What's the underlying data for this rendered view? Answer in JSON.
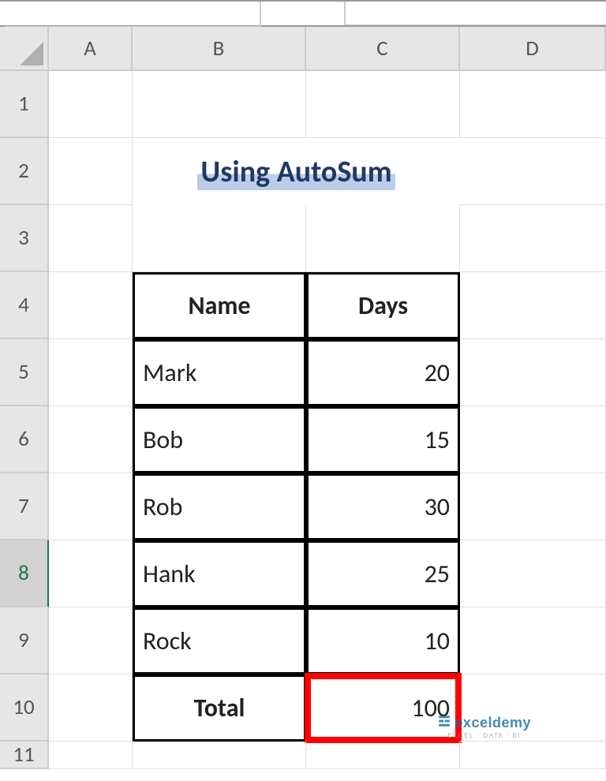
{
  "columns": [
    "A",
    "B",
    "C",
    "D"
  ],
  "rows": [
    "1",
    "2",
    "3",
    "4",
    "5",
    "6",
    "7",
    "8",
    "9",
    "10",
    "11"
  ],
  "active_row": "8",
  "title": "Using AutoSum",
  "table": {
    "headers": {
      "name": "Name",
      "days": "Days"
    },
    "rows": [
      {
        "name": "Mark",
        "days": "20"
      },
      {
        "name": "Bob",
        "days": "15"
      },
      {
        "name": "Rob",
        "days": "30"
      },
      {
        "name": "Hank",
        "days": "25"
      },
      {
        "name": "Rock",
        "days": "10"
      }
    ],
    "total_label": "Total",
    "total_value": "100"
  },
  "watermark": {
    "brand": "exceldemy",
    "tagline": "EXCEL · DATA · BI"
  },
  "chart_data": {
    "type": "table",
    "title": "Using AutoSum",
    "columns": [
      "Name",
      "Days"
    ],
    "rows": [
      [
        "Mark",
        20
      ],
      [
        "Bob",
        15
      ],
      [
        "Rob",
        30
      ],
      [
        "Hank",
        25
      ],
      [
        "Rock",
        10
      ]
    ],
    "total": 100
  }
}
